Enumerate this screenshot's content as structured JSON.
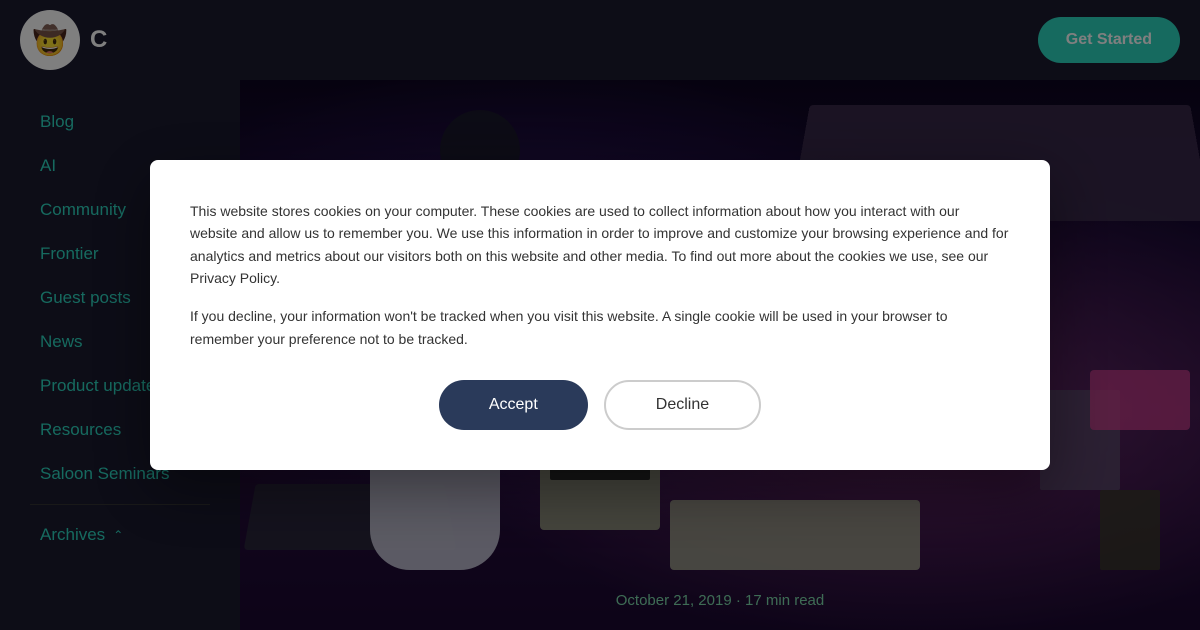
{
  "header": {
    "logo_emoji": "🤠",
    "logo_text": "C",
    "get_started_label": "Get Started"
  },
  "sidebar": {
    "items": [
      {
        "label": "Blog",
        "id": "blog"
      },
      {
        "label": "AI",
        "id": "ai"
      },
      {
        "label": "Community",
        "id": "community"
      },
      {
        "label": "Frontier",
        "id": "frontier"
      },
      {
        "label": "Guest posts",
        "id": "guest-posts"
      },
      {
        "label": "News",
        "id": "news"
      },
      {
        "label": "Product updates",
        "id": "product-updates"
      },
      {
        "label": "Resources",
        "id": "resources"
      },
      {
        "label": "Saloon Seminars",
        "id": "saloon-seminars"
      },
      {
        "label": "Archives",
        "id": "archives"
      }
    ]
  },
  "article": {
    "date": "October 21, 2019",
    "read_time": "17 min read",
    "separator": "·"
  },
  "cookie": {
    "text1": "This website stores cookies on your computer. These cookies are used to collect information about how you interact with our website and allow us to remember you. We use this information in order to improve and customize your browsing experience and for analytics and metrics about our visitors both on this website and other media. To find out more about the cookies we use, see our Privacy Policy.",
    "text2": "If you decline, your information won't be tracked when you visit this website. A single cookie will be used in your browser to remember your preference not to be tracked.",
    "privacy_link_text": "Privacy Policy",
    "accept_label": "Accept",
    "decline_label": "Decline"
  },
  "colors": {
    "accent": "#2dd4bf",
    "sidebar_bg": "#1a1a2e",
    "text_link": "#2dd4bf",
    "modal_bg": "#ffffff",
    "accept_btn_bg": "#2a3a5a",
    "date_color": "#7dd8aa"
  }
}
